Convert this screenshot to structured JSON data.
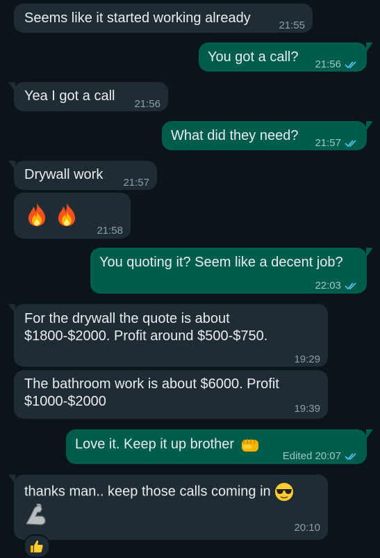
{
  "messages": [
    {
      "text": "Seems like it started working already",
      "time": "21:55",
      "direction": "incoming"
    },
    {
      "text": "You got a call?",
      "time": "21:56",
      "direction": "outgoing",
      "status": "read"
    },
    {
      "text": "Yea I got a call",
      "time": "21:56",
      "direction": "incoming"
    },
    {
      "text": "What did they need?",
      "time": "21:57",
      "direction": "outgoing",
      "status": "read"
    },
    {
      "text": "Drywall work",
      "time": "21:57",
      "direction": "incoming"
    },
    {
      "emoji": [
        "fire-icon",
        "fire-icon"
      ],
      "time": "21:58",
      "direction": "incoming"
    },
    {
      "text": "You quoting it? Seem like a decent job?",
      "time": "22:03",
      "direction": "outgoing",
      "status": "read"
    },
    {
      "text": "For the drywall the quote is about $1800-$2000. Profit around $500-$750.",
      "time": "19:29",
      "direction": "incoming"
    },
    {
      "text": "The bathroom work is about $6000. Profit $1000-$2000",
      "time": "19:39",
      "direction": "incoming"
    },
    {
      "text": "Love it. Keep it up brother",
      "emoji": "fist-icon",
      "time": "Edited 20:07",
      "direction": "outgoing",
      "status": "read"
    },
    {
      "text": "thanks man.. keep those calls coming in",
      "emoji": "sunglasses-face-icon",
      "sticker": "flexed-arm-icon",
      "time": "20:10",
      "direction": "incoming",
      "reaction": "thumbs-up-icon"
    }
  ],
  "colors": {
    "background": "#0b141a",
    "incoming_bubble": "#202c33",
    "outgoing_bubble": "#005c4b",
    "read_ticks": "#53bdeb"
  }
}
